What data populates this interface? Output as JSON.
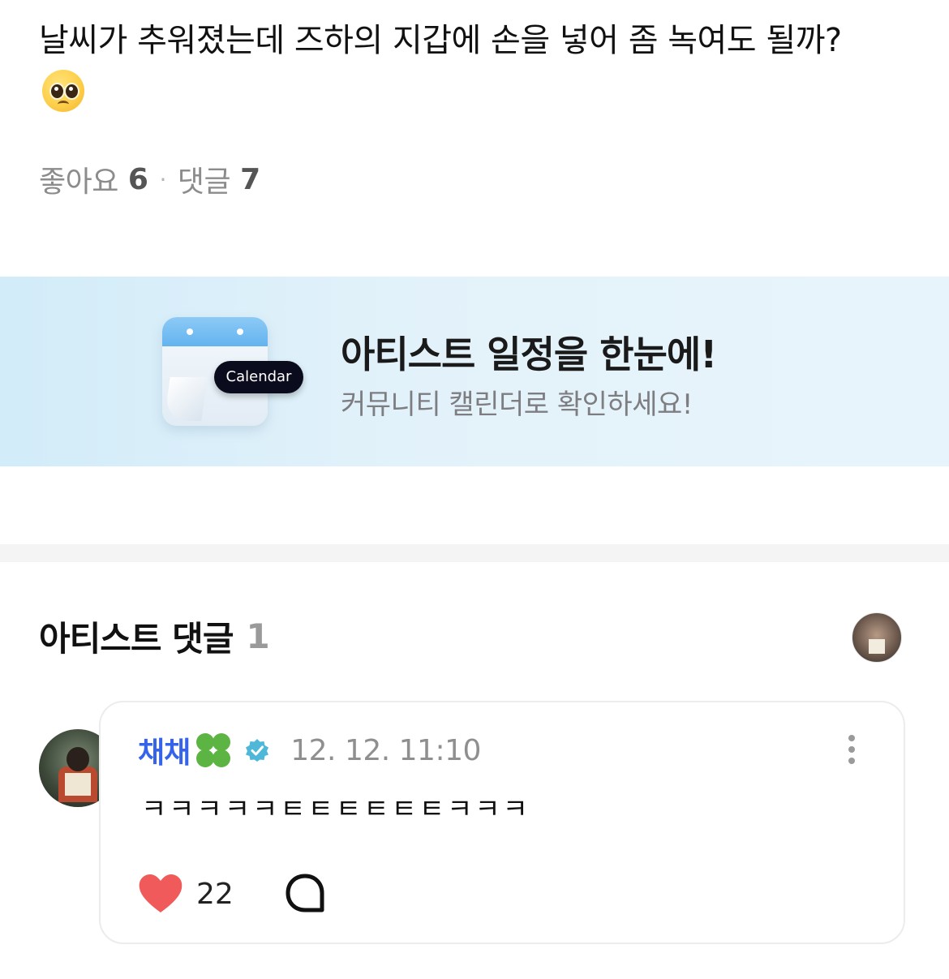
{
  "post": {
    "text": "날씨가 추워졌는데 즈하의 지갑에 손을 넣어 좀 녹여도 될까?",
    "emoji": "pleading-face-icon"
  },
  "stats": {
    "likes_label": "좋아요",
    "likes_count": "6",
    "separator": "·",
    "comments_label": "댓글",
    "comments_count": "7"
  },
  "banner": {
    "icon_pill": "Calendar",
    "title": "아티스트 일정을 한눈에!",
    "subtitle": "커뮤니티 캘린더로 확인하세요!"
  },
  "artist_comments": {
    "title": "아티스트 댓글",
    "count": "1"
  },
  "comment": {
    "author": "채채",
    "time": "12. 12. 11:10",
    "text": "ㅋㅋㅋㅋㅋㅌㅌㅌㅌㅌㅌㅋㅋㅋ",
    "like_count": "22",
    "author_color": "#3563e9",
    "like_color": "#f15a5a",
    "verified_color": "#4fb8d8"
  }
}
